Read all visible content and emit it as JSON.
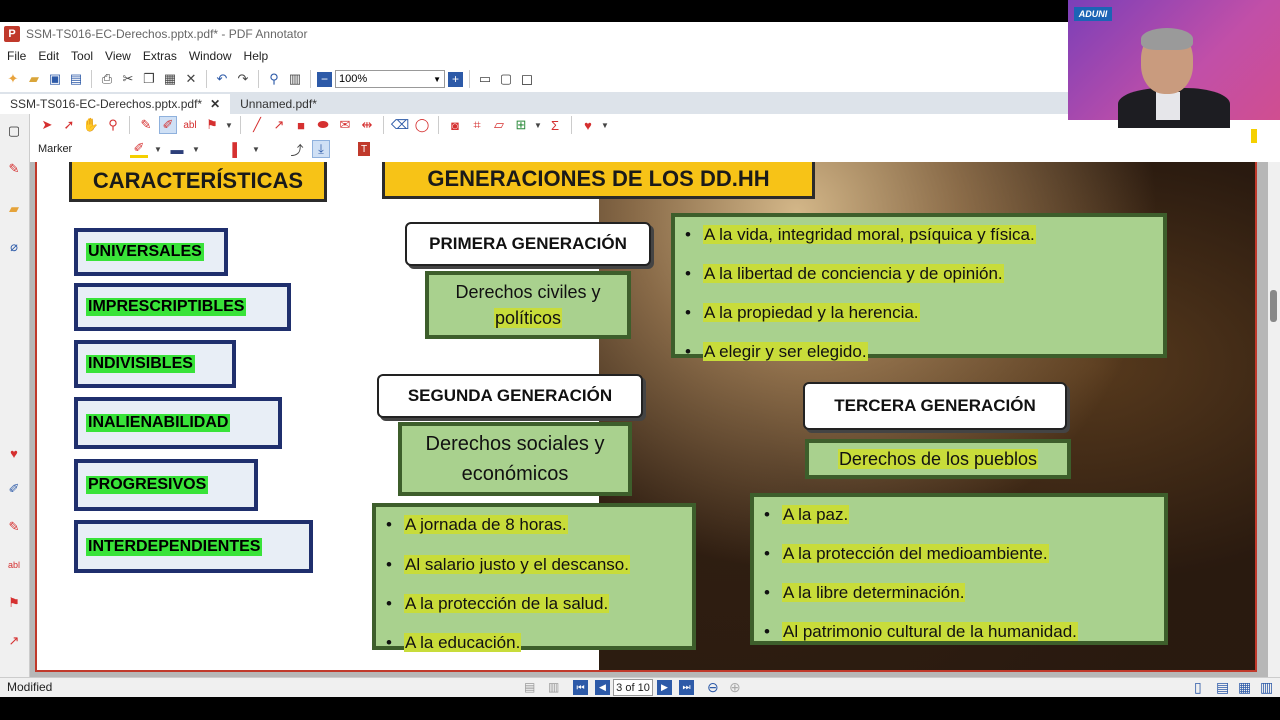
{
  "window": {
    "title": "SSM-TS016-EC-Derechos.pptx.pdf* - PDF Annotator"
  },
  "menu": [
    "File",
    "Edit",
    "Tool",
    "View",
    "Extras",
    "Window",
    "Help"
  ],
  "toolbar": {
    "zoom": "100%"
  },
  "tabs": [
    {
      "label": "SSM-TS016-EC-Derechos.pptx.pdf*",
      "active": true
    },
    {
      "label": "Unnamed.pdf*",
      "active": false
    }
  ],
  "tool_settings": {
    "tool_name": "Marker"
  },
  "slide": {
    "caracteristicas_title": "CARACTERÍSTICAS",
    "generaciones_title": "GENERACIONES DE LOS DD.HH",
    "caracteristicas": [
      "UNIVERSALES",
      "IMPRESCRIPTIBLES",
      "INDIVISIBLES",
      "INALIENABILIDAD",
      "PROGRESIVOS",
      "INTERDEPENDIENTES"
    ],
    "primera": {
      "title": "PRIMERA GENERACIÓN",
      "subtitle_line1": "Derechos civiles y",
      "subtitle_line2": "políticos",
      "items": [
        "A la vida, integridad moral, psíquica y física.",
        "A la libertad de conciencia y de opinión.",
        "A la propiedad y la herencia.",
        "A elegir y ser elegido."
      ]
    },
    "segunda": {
      "title": "SEGUNDA GENERACIÓN",
      "subtitle_line1": "Derechos sociales y",
      "subtitle_line2": "económicos",
      "items": [
        "A jornada de 8 horas.",
        "Al salario justo y el descanso.",
        "A la protección de la salud.",
        "A la educación."
      ]
    },
    "tercera": {
      "title": "TERCERA GENERACIÓN",
      "subtitle": "Derechos de los pueblos",
      "items": [
        "A la paz.",
        "A la protección del medioambiente.",
        "A la libre determinación.",
        "Al patrimonio cultural de la humanidad."
      ]
    }
  },
  "status": {
    "text": "Modified",
    "page_indicator": "3 of 10"
  },
  "webcam": {
    "logo": "ADUNI"
  }
}
